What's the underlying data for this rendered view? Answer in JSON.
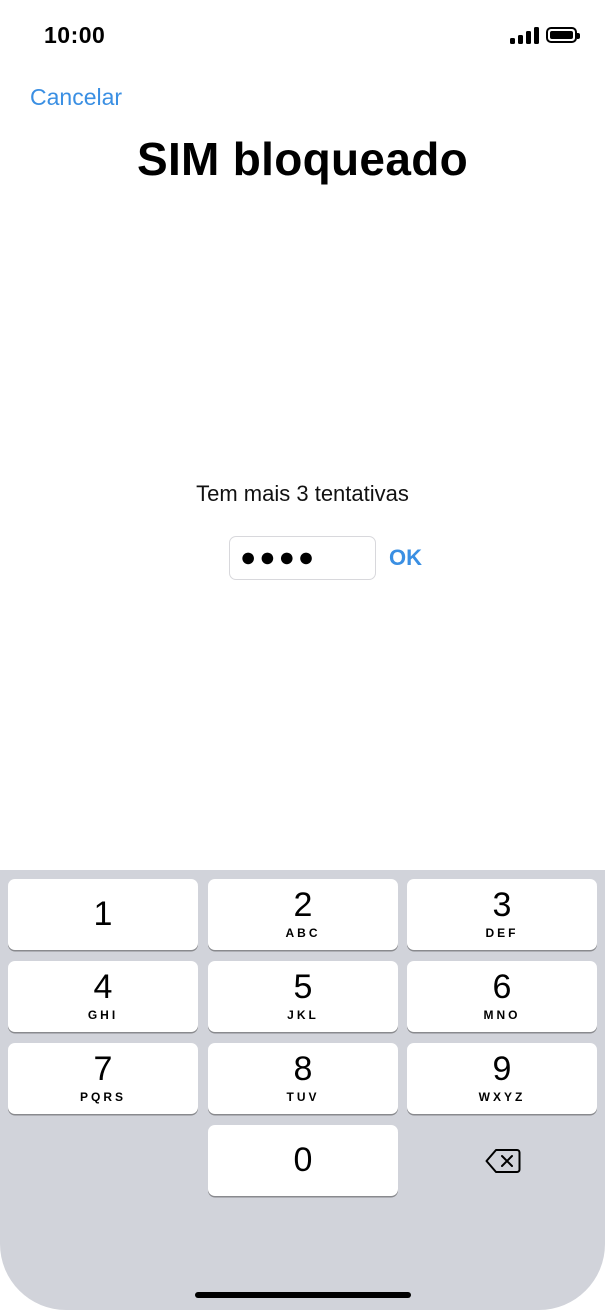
{
  "status_bar": {
    "time": "10:00",
    "signal_icon": "cellular-signal-icon",
    "battery_icon": "battery-full-icon",
    "battery_level": 1.0
  },
  "header": {
    "cancel_label": "Cancelar",
    "title": "SIM bloqueado"
  },
  "pin_entry": {
    "attempts_text": "Tem mais 3 tentativas",
    "masked_value": "●●●●",
    "ok_label": "OK"
  },
  "keypad": {
    "keys": [
      {
        "digit": "1",
        "letters": ""
      },
      {
        "digit": "2",
        "letters": "ABC"
      },
      {
        "digit": "3",
        "letters": "DEF"
      },
      {
        "digit": "4",
        "letters": "GHI"
      },
      {
        "digit": "5",
        "letters": "JKL"
      },
      {
        "digit": "6",
        "letters": "MNO"
      },
      {
        "digit": "7",
        "letters": "PQRS"
      },
      {
        "digit": "8",
        "letters": "TUV"
      },
      {
        "digit": "9",
        "letters": "WXYZ"
      },
      {
        "digit": "0",
        "letters": ""
      }
    ],
    "delete_icon": "backspace-icon"
  },
  "colors": {
    "accent": "#3a8fe3",
    "keypad_background": "#d1d3da"
  }
}
